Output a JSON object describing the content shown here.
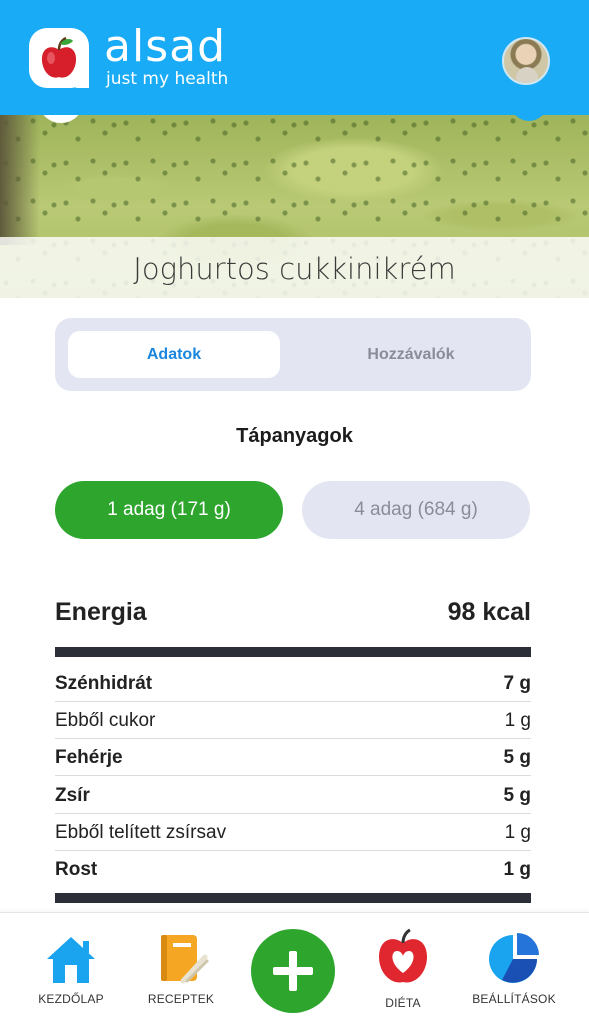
{
  "header": {
    "brand": "alsad",
    "tagline": "just my health",
    "icons": {
      "logo": "apple-logo-icon",
      "avatar": "user-avatar"
    }
  },
  "recipe": {
    "title": "Joghurtos cukkinikrém"
  },
  "tabs": [
    {
      "label": "Adatok",
      "active": true
    },
    {
      "label": "Hozzávalók",
      "active": false
    }
  ],
  "nutrients": {
    "section_title": "Tápanyagok",
    "portions": [
      {
        "label": "1 adag (171 g)",
        "active": true
      },
      {
        "label": "4 adag (684 g)",
        "active": false
      }
    ],
    "energy": {
      "label": "Energia",
      "value": "98 kcal"
    },
    "rows": [
      {
        "label": "Szénhidrát",
        "value": "7 g",
        "bold": true
      },
      {
        "label": "Ebből cukor",
        "value": "1 g",
        "bold": false
      },
      {
        "label": "Fehérje",
        "value": "5 g",
        "bold": true
      },
      {
        "label": "Zsír",
        "value": "5 g",
        "bold": true
      },
      {
        "label": "Ebből telített zsírsav",
        "value": "1 g",
        "bold": false
      },
      {
        "label": "Rost",
        "value": "1 g",
        "bold": true
      }
    ]
  },
  "bottom_nav": [
    {
      "label": "KEZDŐLAP",
      "icon": "home-icon"
    },
    {
      "label": "RECEPTEK",
      "icon": "recipe-book-icon"
    },
    {
      "label": "",
      "icon": "plus-icon"
    },
    {
      "label": "DIÉTA",
      "icon": "apple-heart-icon"
    },
    {
      "label": "BEÁLLÍTÁSOK",
      "icon": "pie-chart-icon"
    }
  ],
  "colors": {
    "header": "#1aabf6",
    "accent_green": "#2ea62e",
    "tab_active_text": "#1a86dd",
    "tab_bg": "#e3e6f2"
  }
}
